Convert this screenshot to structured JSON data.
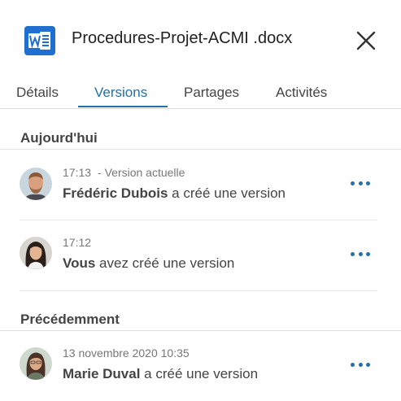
{
  "header": {
    "file_name": "Procedures-Projet-ACMI .docx",
    "file_icon": "word-file-icon",
    "close_icon": "close-icon"
  },
  "tabs": [
    {
      "label": "Détails",
      "active": false
    },
    {
      "label": "Versions",
      "active": true
    },
    {
      "label": "Partages",
      "active": false
    },
    {
      "label": "Activités",
      "active": false
    }
  ],
  "sections": [
    {
      "title": "Aujourd'hui",
      "items": [
        {
          "time": "17:13",
          "note": "- Version actuelle",
          "who": "Frédéric Dubois",
          "action": "a créé une version"
        },
        {
          "time": "17:12",
          "note": "",
          "who": "Vous",
          "action": "avez créé une version"
        }
      ]
    },
    {
      "title": "Précédemment",
      "items": [
        {
          "time": "13 novembre 2020 10:35",
          "note": "",
          "who": "Marie Duval",
          "action": "a créé une version"
        }
      ]
    }
  ],
  "colors": {
    "accent": "#2270a8",
    "word_blue": "#1f6fd0"
  }
}
